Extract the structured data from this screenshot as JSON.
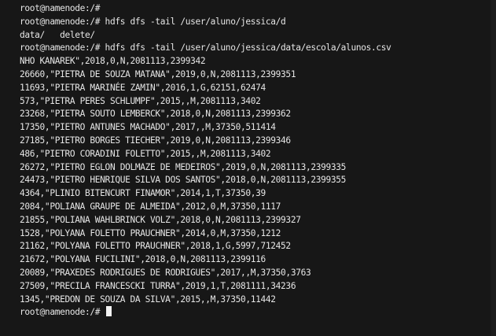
{
  "terminal": {
    "lines": [
      "root@namenode:/#",
      "root@namenode:/# hdfs dfs -tail /user/aluno/jessica/d",
      "data/   delete/",
      "root@namenode:/# hdfs dfs -tail /user/aluno/jessica/data/escola/alunos.csv",
      "NHO KANAREK\",2018,0,N,2081113,2399342",
      "26660,\"PIETRA DE SOUZA MATANA\",2019,0,N,2081113,2399351",
      "11693,\"PIETRA MARINÉE ZAMIN\",2016,1,G,62151,62474",
      "573,\"PIETRA PERES SCHLUMPF\",2015,,M,2081113,3402",
      "23268,\"PIETRA SOUTO LEMBERCK\",2018,0,N,2081113,2399362",
      "17350,\"PIETRO ANTUNES MACHADO\",2017,,M,37350,511414",
      "27185,\"PIETRO BORGES TIECHER\",2019,0,N,2081113,2399346",
      "486,\"PIETRO CORADINI FOLETTO\",2015,,M,2081113,3402",
      "26272,\"PIETRO EGLON DOLMAZE DE MEDEIROS\",2019,0,N,2081113,2399335",
      "24473,\"PIETRO HENRIQUE SILVA DOS SANTOS\",2018,0,N,2081113,2399355",
      "4364,\"PLINIO BITENCURT FINAMOR\",2014,1,T,37350,39",
      "2084,\"POLIANA GRAUPE DE ALMEIDA\",2012,0,M,37350,1117",
      "21855,\"POLIANA WAHLBRINCK VOLZ\",2018,0,N,2081113,2399327",
      "1528,\"POLYANA FOLETTO PRAUCHNER\",2014,0,M,37350,1212",
      "21162,\"POLYANA FOLETTO PRAUCHNER\",2018,1,G,5997,712452",
      "21672,\"POLYANA FUCILINI\",2018,0,N,2081113,2399116",
      "20089,\"PRAXEDES RODRIGUES DE RODRIGUES\",2017,,M,37350,3763",
      "27509,\"PRECILA FRANCESCKI TURRA\",2019,1,T,2081111,34236",
      "1345,\"PREDON DE SOUZA DA SILVA\",2015,,M,37350,11442"
    ],
    "prompt": "root@namenode:/#"
  }
}
